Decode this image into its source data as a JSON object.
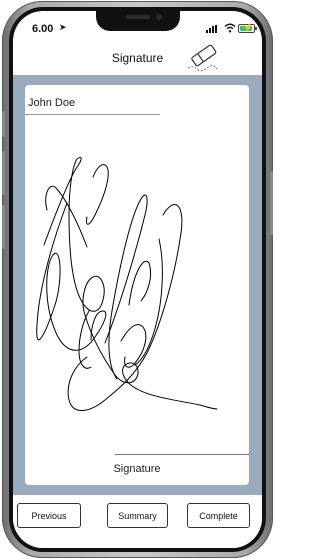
{
  "status_bar": {
    "time": "6.00",
    "location_icon": "location-arrow-icon",
    "signal_icon": "cellular-signal-icon",
    "wifi_icon": "wifi-icon",
    "battery_icon": "battery-charging-icon",
    "battery_color": "#34c759"
  },
  "nav": {
    "title": "Signature",
    "clear_icon": "eraser-icon"
  },
  "signature_form": {
    "signer_name": "John Doe",
    "signature_label": "Signature"
  },
  "footer": {
    "previous_label": "Previous",
    "summary_label": "Summary",
    "complete_label": "Complete"
  },
  "colors": {
    "content_background": "#9aabbf",
    "ink": "#000000"
  }
}
